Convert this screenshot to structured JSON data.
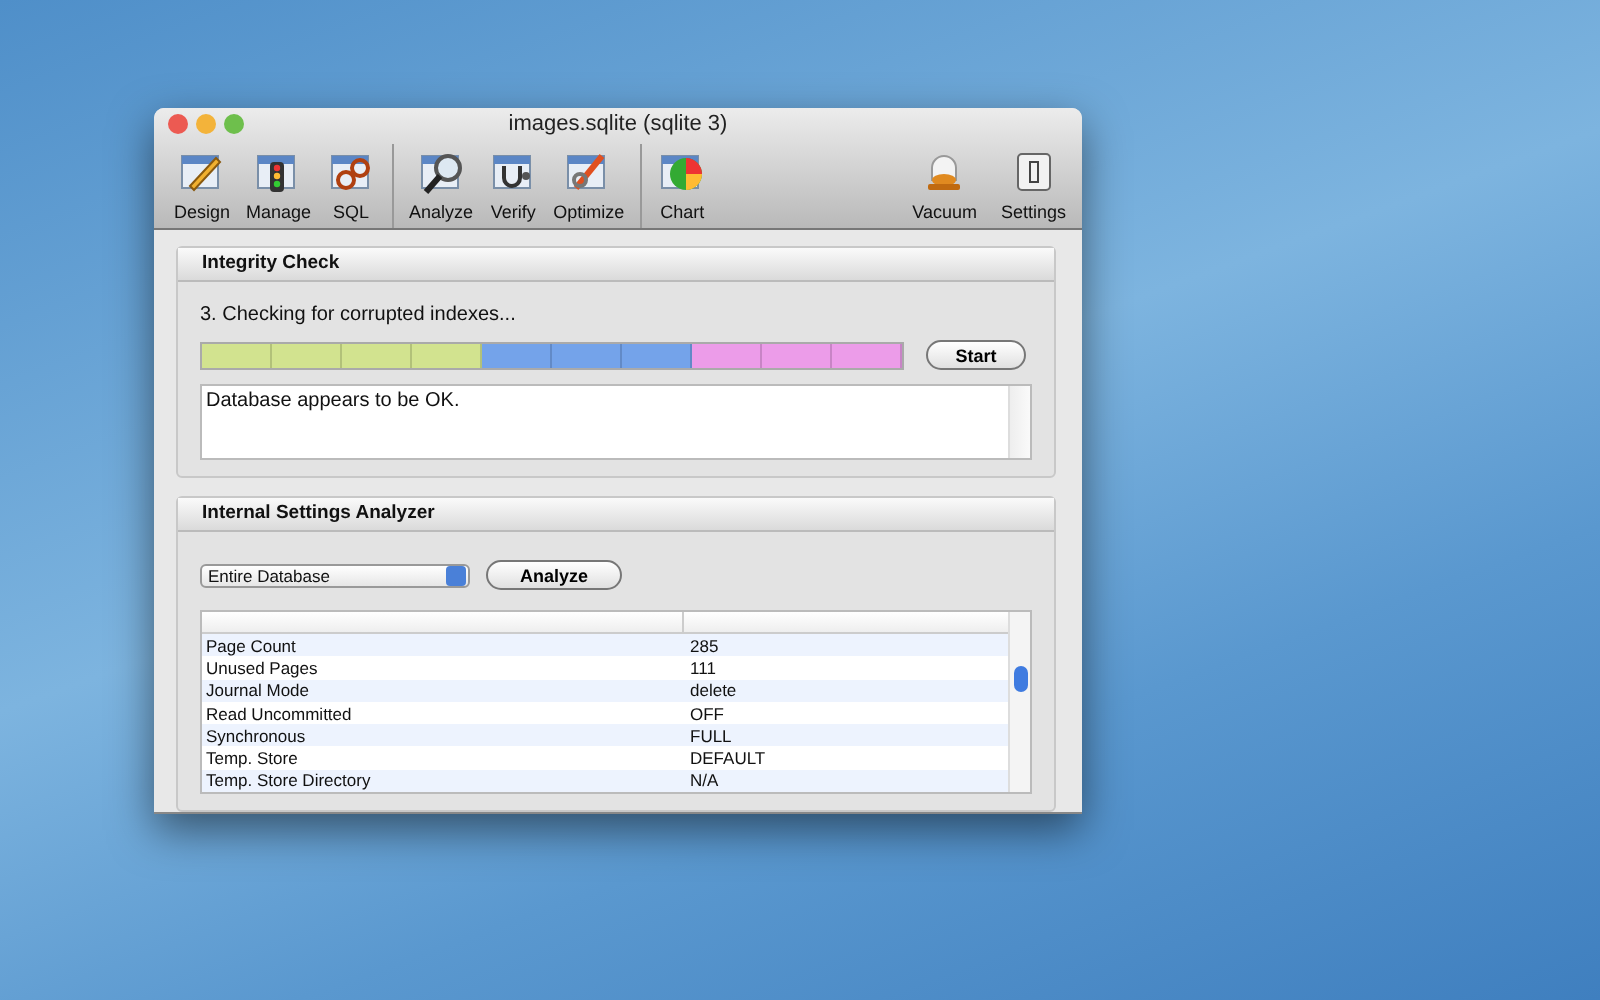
{
  "window": {
    "title": "images.sqlite (sqlite 3)"
  },
  "toolbar": {
    "groups": [
      [
        {
          "label": "Design",
          "kind": "design"
        },
        {
          "label": "Manage",
          "kind": "manage"
        },
        {
          "label": "SQL",
          "kind": "sql"
        }
      ],
      [
        {
          "label": "Analyze",
          "kind": "analyze"
        },
        {
          "label": "Verify",
          "kind": "verify"
        },
        {
          "label": "Optimize",
          "kind": "optimize"
        }
      ],
      [
        {
          "label": "Chart",
          "kind": "chart"
        }
      ]
    ],
    "right": [
      {
        "label": "Vacuum",
        "kind": "vacuum"
      },
      {
        "label": "Settings",
        "kind": "settings"
      }
    ]
  },
  "integrity_check": {
    "title": "Integrity Check",
    "status": "3. Checking for corrupted indexes...",
    "segments": [
      {
        "color": "#d2e38f"
      },
      {
        "color": "#d2e38f"
      },
      {
        "color": "#d2e38f"
      },
      {
        "color": "#d2e38f"
      },
      {
        "color": "#74a3ea"
      },
      {
        "color": "#74a3ea"
      },
      {
        "color": "#74a3ea"
      },
      {
        "color": "#ec9ce9"
      },
      {
        "color": "#ec9ce9"
      },
      {
        "color": "#ec9ce9"
      }
    ],
    "start_button": "Start",
    "output": "Database appears to be OK."
  },
  "settings_analyzer": {
    "title": "Internal Settings Analyzer",
    "scope": "Entire Database",
    "analyze_button": "Analyze",
    "rows": [
      {
        "name": "Page Count",
        "value": "285"
      },
      {
        "name": "Unused Pages",
        "value": "111"
      },
      {
        "name": "Journal Mode",
        "value": "delete"
      },
      {
        "name": "Read Uncommitted",
        "value": "OFF"
      },
      {
        "name": "Synchronous",
        "value": "FULL"
      },
      {
        "name": "Temp. Store",
        "value": "DEFAULT"
      },
      {
        "name": "Temp. Store Directory",
        "value": "N/A"
      }
    ]
  }
}
